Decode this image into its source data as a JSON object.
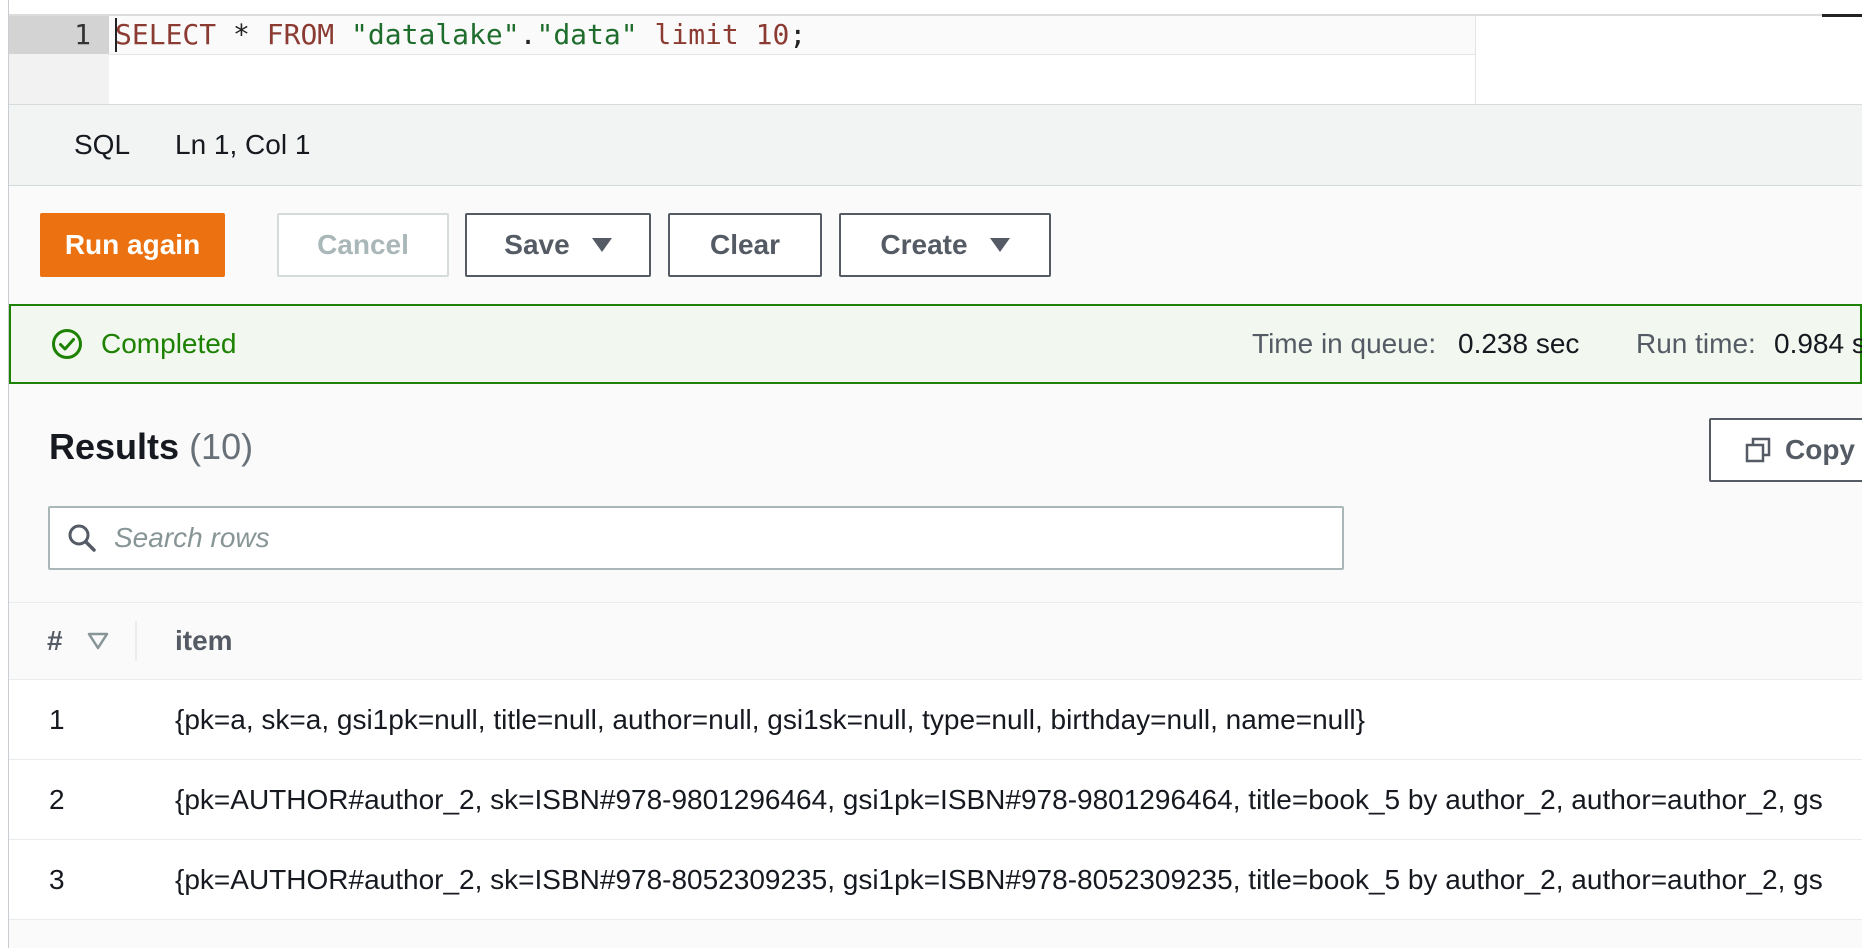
{
  "editor": {
    "line_number": "1",
    "tokens": {
      "select": "SELECT",
      "star": " * ",
      "from": "FROM",
      "space1": " ",
      "db": "\"datalake\"",
      "dot": ".",
      "table": "\"data\"",
      "space2": " ",
      "limit": "limit",
      "space3": " ",
      "num": "10",
      "semi": ";"
    }
  },
  "statusbar": {
    "language": "SQL",
    "cursor_position": "Ln 1, Col 1"
  },
  "toolbar": {
    "run_again": "Run again",
    "cancel": "Cancel",
    "save": "Save",
    "clear": "Clear",
    "create": "Create"
  },
  "status": {
    "text": "Completed",
    "color": "#1d8102",
    "time_in_queue_label": "Time in queue:",
    "time_in_queue_value": "0.238 sec",
    "run_time_label": "Run time:",
    "run_time_value": "0.984 s"
  },
  "results": {
    "title": "Results",
    "count": "(10)",
    "copy_label": "Copy",
    "search_placeholder": "Search rows",
    "columns": {
      "num": "#",
      "item": "item"
    },
    "rows": [
      {
        "num": "1",
        "item": "{pk=a, sk=a, gsi1pk=null, title=null, author=null, gsi1sk=null, type=null, birthday=null, name=null}"
      },
      {
        "num": "2",
        "item": "{pk=AUTHOR#author_2, sk=ISBN#978-9801296464, gsi1pk=ISBN#978-9801296464, title=book_5 by author_2, author=author_2, gs"
      },
      {
        "num": "3",
        "item": "{pk=AUTHOR#author_2, sk=ISBN#978-8052309235, gsi1pk=ISBN#978-8052309235, title=book_5 by author_2, author=author_2, gs"
      }
    ]
  },
  "colors": {
    "primary": "#ec7211",
    "success": "#1d8102",
    "border": "#545b64"
  },
  "icons": {
    "status": "check-circle-icon",
    "copy": "copy-icon",
    "search": "search-icon",
    "sort": "sort-down-icon",
    "dropdown": "caret-down-icon"
  }
}
